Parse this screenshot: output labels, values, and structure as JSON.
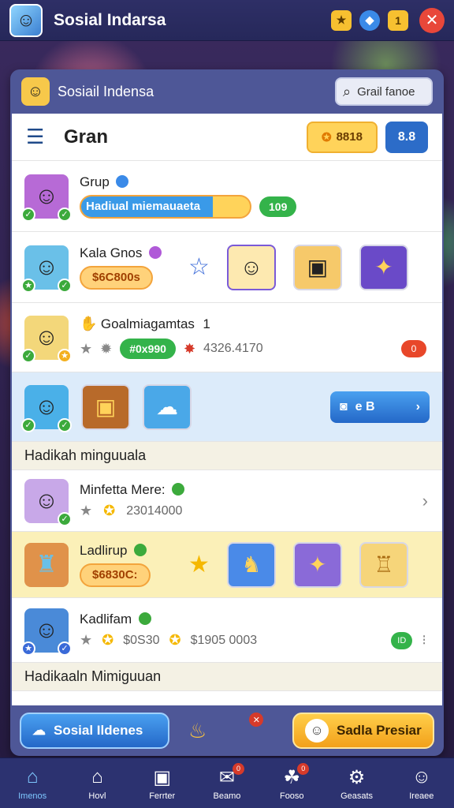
{
  "app": {
    "title": "Sosial Indarsa",
    "colors": {
      "topbar": "#2e2f66",
      "accent": "#2c6cc8",
      "close": "#e8473a"
    }
  },
  "topbar": {
    "icons": [
      {
        "name": "trophy-icon",
        "glyph": "★"
      },
      {
        "name": "location-icon",
        "glyph": "◆"
      },
      {
        "name": "notification-icon",
        "glyph": "1"
      }
    ],
    "close_glyph": "✕"
  },
  "panel": {
    "title": "Sosiail Indensa",
    "search_label": "Grail fanoe"
  },
  "header": {
    "title": "Gran",
    "coins": "8818",
    "level": "8.8"
  },
  "rows": {
    "r1": {
      "name": "Grup",
      "progress_label": "Hadiual miemauaeta",
      "progress_fraction": 0.78,
      "score": "109"
    },
    "r2": {
      "name": "Kala Gnos",
      "amount": "$6C800s"
    },
    "r3": {
      "name": "Goalmiagamtas",
      "mark": "1",
      "amount": "#0x990",
      "stat": "4326.4170",
      "dot": "0"
    },
    "r4": {
      "button_value": "e B"
    },
    "section1": "Hadikah minguuala",
    "r5": {
      "name": "Minfetta Mere:",
      "stat": "23014000"
    },
    "r6": {
      "name": "Ladlirup",
      "amount": "$6830C:"
    },
    "r7": {
      "name": "Kadlifam",
      "stat1": "$0S30",
      "stat2": "$1905 0003",
      "badge": "ID"
    },
    "section2": "Hadikaaln Mimiguuan"
  },
  "actions": {
    "left_label": "Sosial Ildenes",
    "right_label": "Sadla Presiar",
    "badge": "✕"
  },
  "nav": [
    {
      "label": "Imenos",
      "icon": "home-icon",
      "glyph": "⌂",
      "active": true
    },
    {
      "label": "Hovl",
      "icon": "house-icon",
      "glyph": "⌂",
      "active": false
    },
    {
      "label": "Ferrter",
      "icon": "screen-icon",
      "glyph": "▣",
      "active": false
    },
    {
      "label": "Beamo",
      "icon": "chat-icon",
      "glyph": "✉",
      "active": false,
      "badge": "0"
    },
    {
      "label": "Fooso",
      "icon": "game-icon",
      "glyph": "☘",
      "active": false,
      "badge": "0"
    },
    {
      "label": "Geasats",
      "icon": "gear-icon",
      "glyph": "⚙",
      "active": false
    },
    {
      "label": "Ireaee",
      "icon": "profile-icon",
      "glyph": "☺",
      "active": false
    }
  ]
}
